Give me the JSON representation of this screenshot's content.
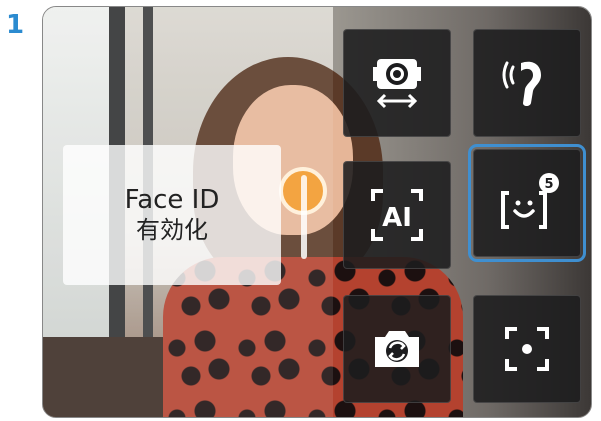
{
  "step": {
    "number": "1"
  },
  "faceid_panel": {
    "title": "Face ID",
    "subtitle": "有効化"
  },
  "tiles": [
    {
      "icon": "camera-swap-horizontal-icon"
    },
    {
      "icon": "voice-gesture-icon"
    },
    {
      "icon": "ai-frame-icon",
      "text": "AI"
    },
    {
      "icon": "face-detect-icon",
      "badge": "5",
      "selected": true
    },
    {
      "icon": "camera-flip-icon"
    },
    {
      "icon": "focus-point-icon"
    }
  ],
  "colors": {
    "accent": "#2b8bd0",
    "selection": "#3f8fd0",
    "tile_bg": "#1c1c1e"
  }
}
